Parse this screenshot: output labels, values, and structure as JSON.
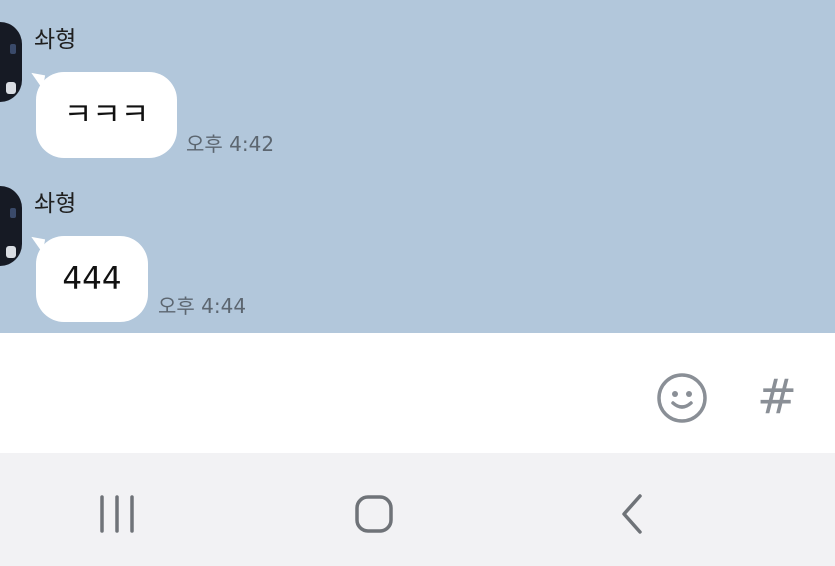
{
  "messages": [
    {
      "sender": "솨형",
      "text": "ㅋㅋㅋ",
      "time": "오후 4:42"
    },
    {
      "sender": "솨형",
      "text": "444",
      "time": "오후 4:44"
    }
  ],
  "input_bar": {
    "emoji_icon": "emoji-icon",
    "hash_label": "#"
  },
  "nav": {
    "recents_icon": "recents-icon",
    "home_icon": "home-icon",
    "back_icon": "back-icon"
  },
  "colors": {
    "chat_background": "#b2c7db",
    "bubble": "#ffffff",
    "nav_background": "#f2f2f4"
  }
}
